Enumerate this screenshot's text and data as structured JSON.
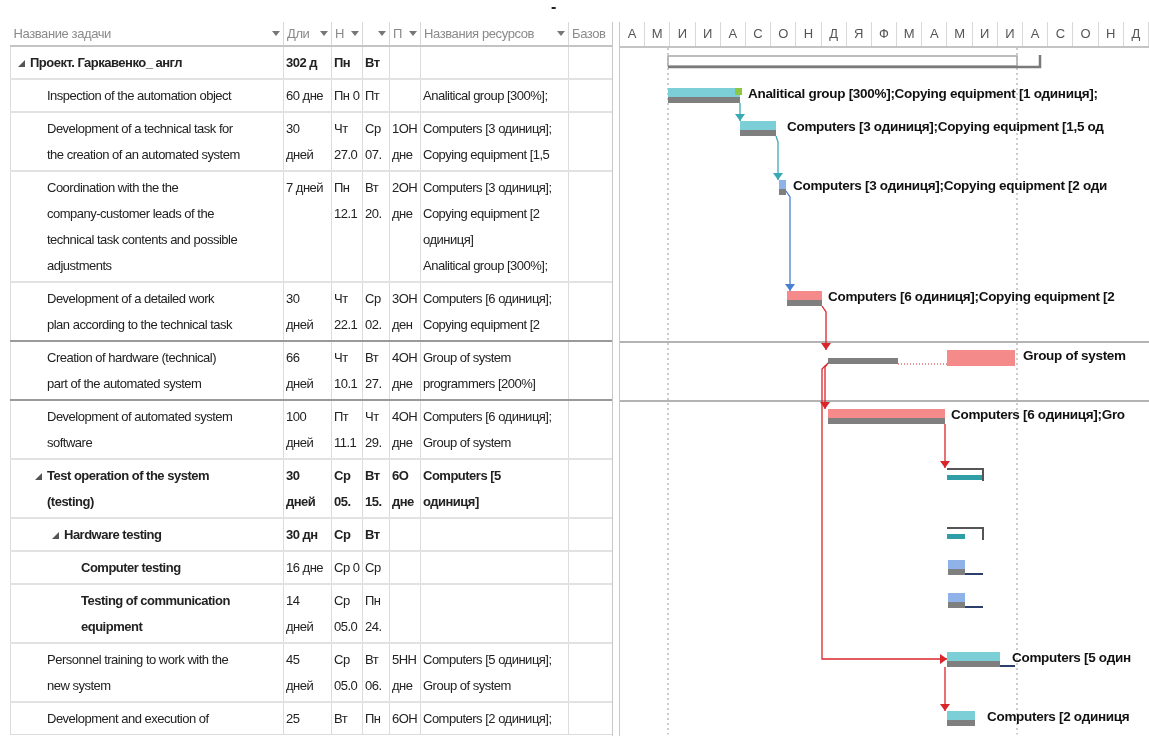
{
  "page_mark": "-",
  "columns": [
    {
      "label": "Название задачи",
      "filter": true
    },
    {
      "label": "Дли",
      "filter": true
    },
    {
      "label": "Н",
      "filter": true
    },
    {
      "filter": true
    },
    {
      "label": "П",
      "filter": true
    },
    {
      "label": "Названия ресурсов",
      "filter": true
    },
    {
      "label": "Базов",
      "filter": false
    }
  ],
  "timeline": [
    "А",
    "М",
    "И",
    "И",
    "А",
    "С",
    "О",
    "Н",
    "Д",
    "Я",
    "Ф",
    "М",
    "А",
    "М",
    "И",
    "И",
    "А",
    "С",
    "О",
    "Н",
    "Д"
  ],
  "tasks": [
    {
      "kind": "summary",
      "expanded": true,
      "name": "Проект. Гаркавенко_ англ",
      "duration": "302 д",
      "start": "Пн",
      "finish": "Вт",
      "children": [
        {
          "kind": "task",
          "name": "Inspection of the automation object",
          "duration": "60 дне",
          "start": "Пн 0",
          "finish": "Пт",
          "resources": "Analitical group [300%];",
          "bar_label": "Analitical group [300%];Copying equipment [1 одиниця];"
        },
        {
          "kind": "task",
          "name": "Development of a technical task for\nthe creation of an automated system",
          "duration": "30\nдней",
          "start": "Чт\n27.0",
          "finish": "Ср\n07.",
          "predecessors": "1ОН\nдне",
          "resources": "Computers [3 одиниця];\nCopying equipment [1,5",
          "bar_label": "Computers [3 одиниця];Copying equipment [1,5 од"
        },
        {
          "kind": "task",
          "name": "Coordination with the the\ncompany-customer leads of the\ntechnical task contents and possible\nadjustments",
          "duration": "7 дней",
          "start": "Пн\n12.1",
          "finish": "Вт\n20.",
          "predecessors": "2ОН\nдне",
          "resources": "Computers [3 одиниця];\nCopying equipment [2\nодиниця]\nAnalitical group [300%];",
          "bar_label": "Computers [3 одиниця];Copying equipment [2 оди"
        },
        {
          "kind": "task",
          "name": "Development of a detailed work\nplan according to the technical task",
          "duration": "30\nдней",
          "start": "Чт\n22.1",
          "finish": "Ср\n02.",
          "predecessors": "3ОН\nден",
          "resources": "Computers [6 одиниця];\nCopying equipment [2",
          "bar_label": "Computers [6 одиниця];Copying equipment [2"
        },
        {
          "kind": "task",
          "name": "Creation of hardware (technical)\npart of the automated system",
          "duration": "66\nдней",
          "start": "Чт\n10.1",
          "finish": "Вт\n27.",
          "predecessors": "4ОН\nдне",
          "resources": "Group of system\nprogrammers [200%]",
          "bar_label": "Group of system"
        },
        {
          "kind": "task",
          "name": "Development of automated system\nsoftware",
          "duration": "100\nдней",
          "start": "Пт\n11.1",
          "finish": "Чт\n29.",
          "predecessors": "4ОН\nдне",
          "resources": "Computers [6 одиниця];\nGroup of system",
          "bar_label": "Computers [6 одиниця];Gro"
        },
        {
          "kind": "summary",
          "expanded": true,
          "name": "Test operation of the system\n(testing)",
          "duration": "30\nдней",
          "start": "Ср\n05.",
          "finish": "Вт\n15.",
          "predecessors": "6О\nдне",
          "resources": "Computers [5\nодиниця]",
          "children": [
            {
              "kind": "summary",
              "expanded": true,
              "name": "Hardware testing",
              "duration": "30 дн",
              "start": "Ср",
              "finish": "Вт",
              "children": [
                {
                  "kind": "task",
                  "name_bold": true,
                  "name": "Computer testing",
                  "duration": "16 дне",
                  "start": "Ср 0",
                  "finish": "Ср"
                },
                {
                  "kind": "task",
                  "name_bold": true,
                  "name": "Testing of communication\nequipment",
                  "duration": "14\nдней",
                  "start": "Ср\n05.0",
                  "finish": "Пн\n24."
                }
              ]
            }
          ]
        },
        {
          "kind": "task",
          "name": "Personnel training to work with the\nnew system",
          "duration": "45\nдней",
          "start": "Ср\n05.0",
          "finish": "Вт\n06.",
          "predecessors": "5НН\nдне",
          "resources": "Computers [5 одиниця];\nGroup of system",
          "bar_label": "Computers [5 один"
        },
        {
          "kind": "task",
          "name": "Development and execution of",
          "duration": "25",
          "start": "Вт",
          "finish": "Пн",
          "predecessors": "6ОН",
          "resources": "Computers [2 одиниця];",
          "bar_label": "Computers [2 одиниця"
        }
      ]
    }
  ]
}
